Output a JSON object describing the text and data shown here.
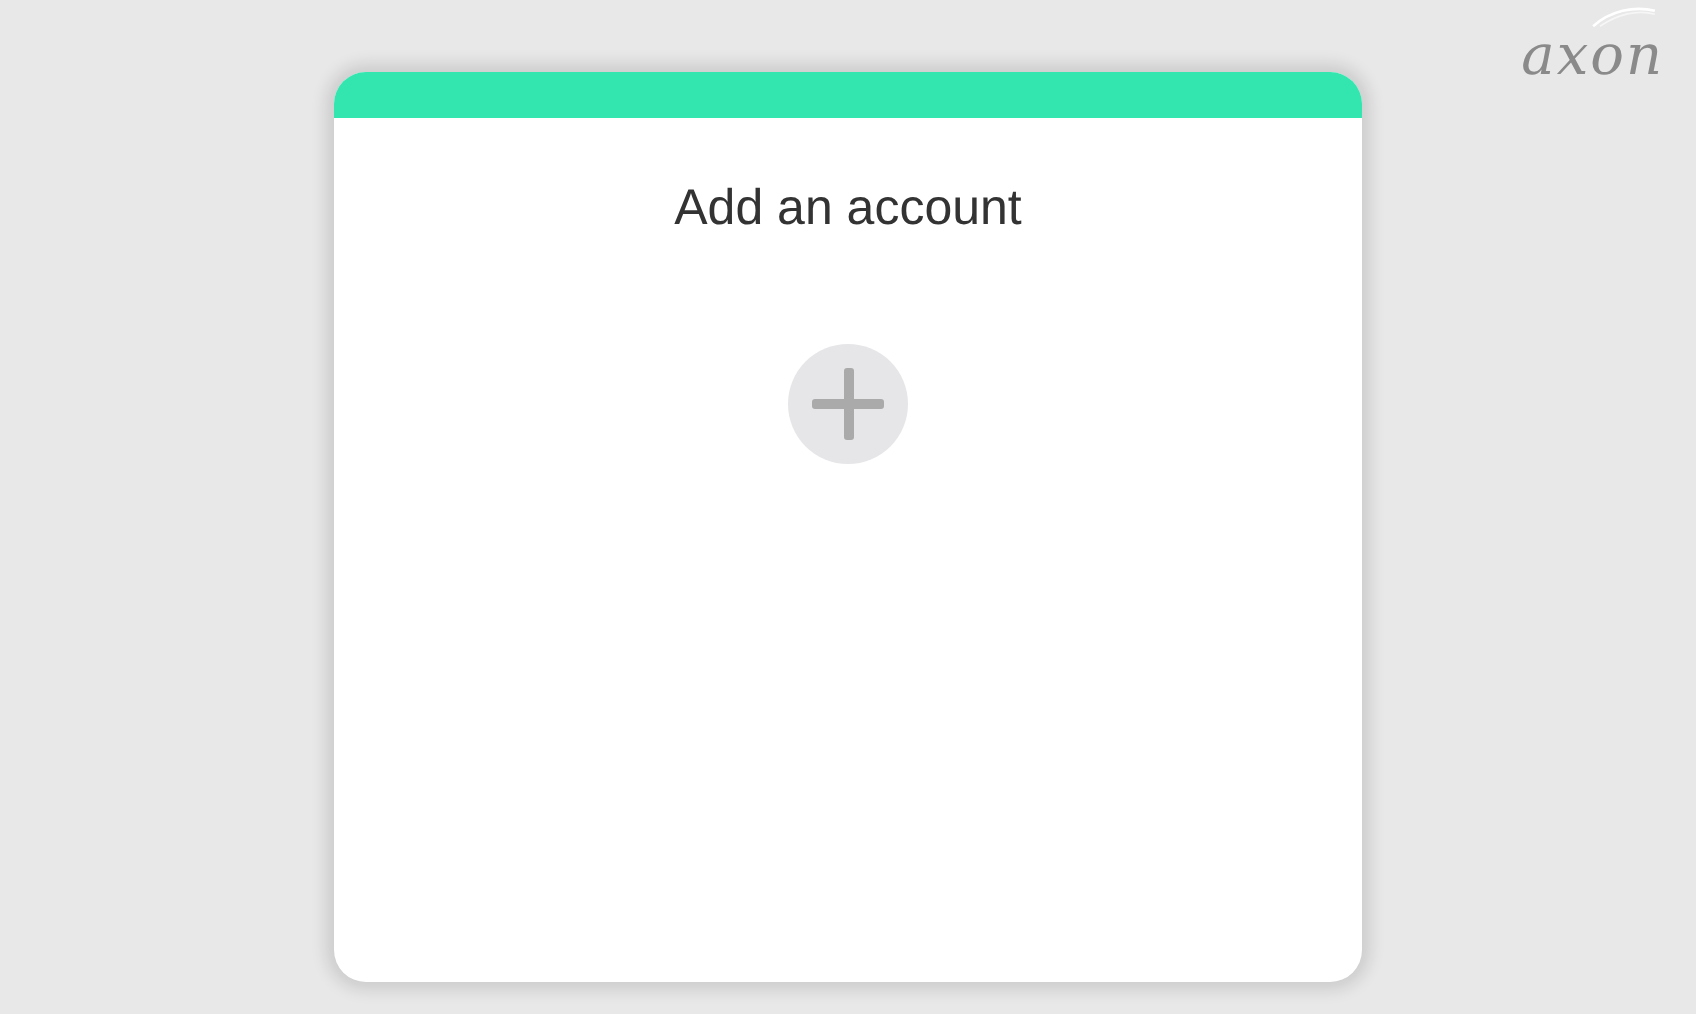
{
  "logo": {
    "text": "axon"
  },
  "card": {
    "title": "Add an account"
  }
}
